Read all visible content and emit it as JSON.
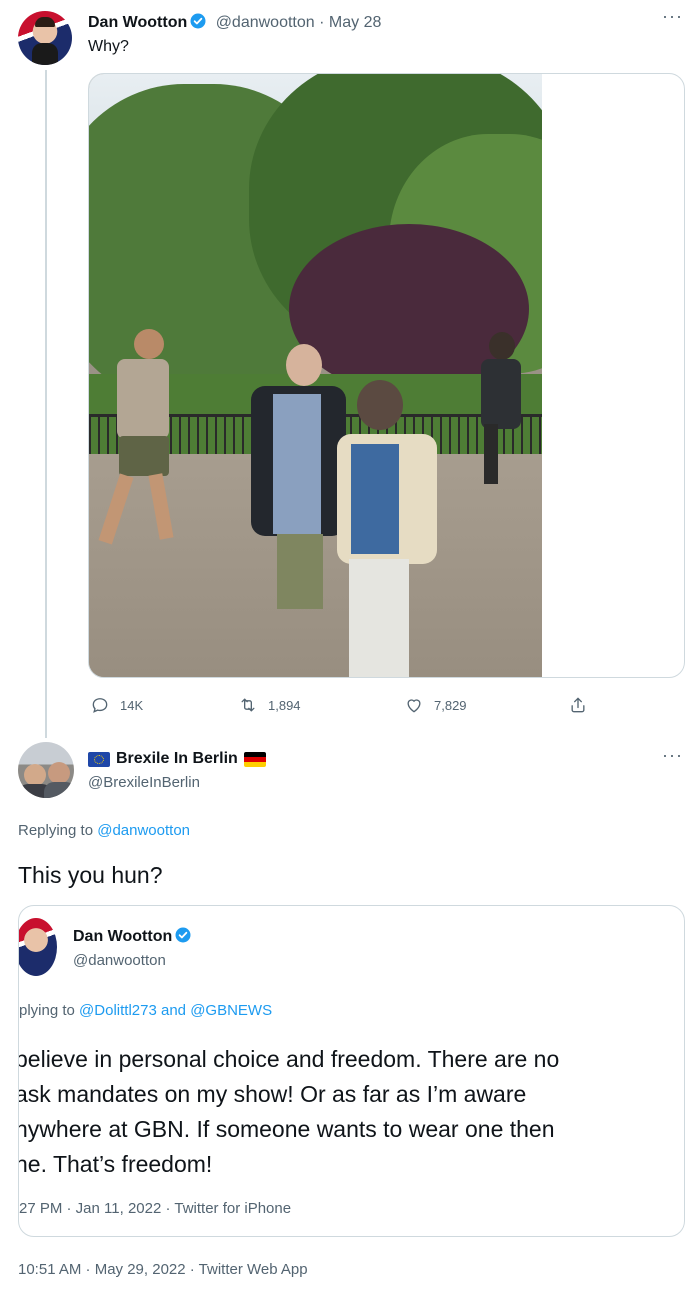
{
  "tweet1": {
    "author": "Dan Wootton",
    "handle": "@danwootton",
    "separator": "·",
    "date": "May 28",
    "text": "Why?",
    "replies": "14K",
    "retweets": "1,894",
    "likes": "7,829",
    "more": "···"
  },
  "tweet2": {
    "author": "Brexile In Berlin",
    "handle": "@BrexileInBerlin",
    "more": "···",
    "replying_prefix": "Replying to",
    "replying_handle": "@danwootton",
    "text": "This you hun?",
    "timestamp": "10:51 AM · May 29, 2022 · Twitter Web App"
  },
  "quoted": {
    "author": "Dan Wootton",
    "handle": "@danwootton",
    "replying_prefix": "plying to",
    "replying_handle1": "@Dolittl273",
    "replying_and": "and",
    "replying_handle2": "@GBNEWS",
    "lines": [
      "believe in personal choice and freedom. There are no",
      "ask mandates on my show! Or as far as I’m aware",
      "nywhere at GBN. If someone wants to wear one then",
      "ne. That’s freedom!"
    ],
    "timestamp": "27 PM · Jan 11, 2022 · Twitter for iPhone"
  },
  "icons": [
    "verified-badge-icon",
    "reply-icon",
    "retweet-icon",
    "like-icon",
    "share-icon",
    "eu-flag-icon",
    "germany-flag-icon"
  ],
  "colors": {
    "link": "#1d9bf0",
    "muted": "#536471",
    "verified": "#1d9bf0"
  }
}
